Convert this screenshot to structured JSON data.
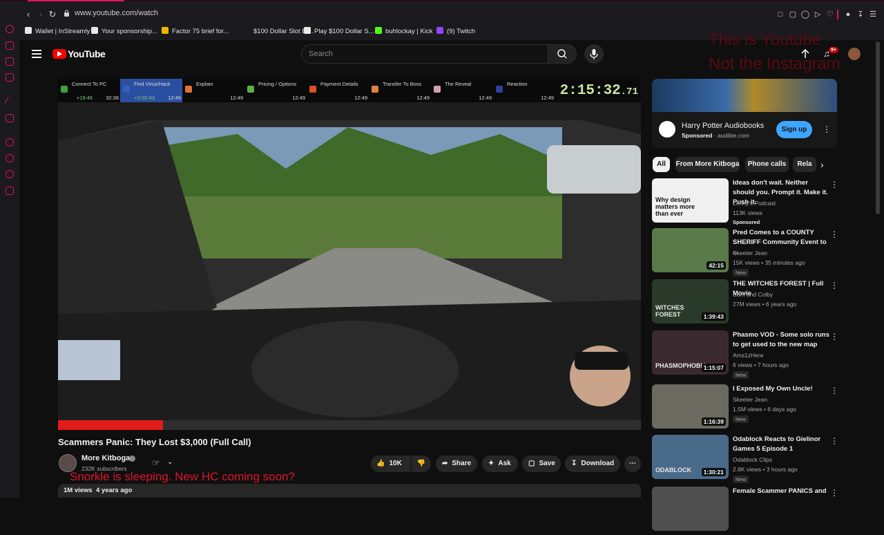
{
  "browser": {
    "url": "www.youtube.com/watch",
    "bookmarks": [
      {
        "label": "Wallet | InStreamly",
        "color": "#e8e8e8"
      },
      {
        "label": "Your sponsorship...",
        "color": "#e8e8e8"
      },
      {
        "label": "Factor 75 brief for...",
        "color": "#f0b400"
      },
      {
        "label": "$100 Dollar Slot Bl...",
        "color": "#1b1a1f"
      },
      {
        "label": "Play $100 Dollar S...",
        "color": "#e8e8e8"
      },
      {
        "label": "buhlockay | Kick",
        "color": "#53fc18"
      },
      {
        "label": "(9) Twitch",
        "color": "#9146ff"
      }
    ]
  },
  "header": {
    "logo_text": "YouTube",
    "search_placeholder": "Search",
    "notifications_badge": "9+",
    "overlay_text_line1": "This is Youtube",
    "overlay_text_line2": "Not the Instagram"
  },
  "video": {
    "splits": [
      {
        "name": "Connect To PC",
        "delta": "+19:46",
        "time": "32:36",
        "color": "#3ba33b"
      },
      {
        "name": "Find Virus/Hack",
        "delta": "+2:02:43",
        "time": "12:49",
        "color": "#3060c0",
        "active": true
      },
      {
        "name": "Explain",
        "delta": "",
        "time": "12:49",
        "color": "#e07030"
      },
      {
        "name": "Pricing / Options",
        "delta": "",
        "time": "12:49",
        "color": "#5ab040"
      },
      {
        "name": "Payment Details",
        "delta": "",
        "time": "12:49",
        "color": "#e05020"
      },
      {
        "name": "Transfer To Boss",
        "delta": "",
        "time": "12:49",
        "color": "#e08040"
      },
      {
        "name": "The Reveal",
        "delta": "",
        "time": "12:49",
        "color": "#d0a0b0"
      },
      {
        "name": "Reaction",
        "delta": "",
        "time": "12:49",
        "color": "#3040a0"
      }
    ],
    "timer_main": "2:15:32",
    "timer_fraction": ".71",
    "progress": 0.18,
    "title": "Scammers Panic: They Lost $3,000 (Full Call)",
    "channel": "More Kitboga",
    "subscribers": "232K subscribers",
    "overlay_caption": "Snorkle is sleeping. New HC coming soon?",
    "likes": "10K",
    "share_label": "Share",
    "ask_label": "Ask",
    "save_label": "Save",
    "download_label": "Download",
    "views": "1M views",
    "age": "4 years ago"
  },
  "ad": {
    "title": "Harry Potter Audiobooks",
    "sponsored": "Sponsored",
    "domain": "audible.com",
    "cta": "Sign up"
  },
  "chips": [
    "All",
    "From More Kitboga",
    "Phone calls",
    "Rela"
  ],
  "recommendations": [
    {
      "title": "Ideas don't wait. Neither should you. Prompt it. Make it. Push it.",
      "channel": "Lenny's Podcast",
      "views": "113K views",
      "badge": "Sponsored",
      "duration": "",
      "thumb_text": "Why design matters more than ever",
      "thumb_bg": "#f0f0f0"
    },
    {
      "title": "Pred Comes to a COUNTY SHERIFF Community Event to ...",
      "channel": "Skeeter Jean",
      "views": "15K views • 35 minutes ago",
      "badge": "New",
      "duration": "42:15",
      "thumb_text": "",
      "thumb_bg": "#5a7a4a"
    },
    {
      "title": "THE WITCHES FOREST | Full Movie",
      "channel": "Sam and Colby",
      "views": "27M views • 6 years ago",
      "badge": "",
      "duration": "1:39:43",
      "thumb_text": "WITCHES FOREST",
      "thumb_bg": "#2a3a2a"
    },
    {
      "title": "Phasmo VOD - Some solo runs to get used to the new map",
      "channel": "Ams1zHere",
      "views": "6 views • 7 hours ago",
      "badge": "New",
      "duration": "1:15:07",
      "thumb_text": "PHASMOPHOBIA",
      "thumb_bg": "#3a2a30"
    },
    {
      "title": "I Exposed My Own Uncle!",
      "channel": "Skeeter Jean",
      "views": "1.5M views • 6 days ago",
      "badge": "New",
      "duration": "1:16:39",
      "thumb_text": "",
      "thumb_bg": "#6a6a60"
    },
    {
      "title": "Odablock Reacts to Gielinor Games 5 Episode 1",
      "channel": "Odablock Clips",
      "views": "2.8K views • 3 hours ago",
      "badge": "New",
      "duration": "1:30:21",
      "thumb_text": "ODABLOCK",
      "thumb_bg": "#4a6a8a"
    },
    {
      "title": "Female Scammer PANICS and",
      "channel": "",
      "views": "",
      "badge": "",
      "duration": "",
      "thumb_text": "",
      "thumb_bg": "#505050"
    }
  ]
}
